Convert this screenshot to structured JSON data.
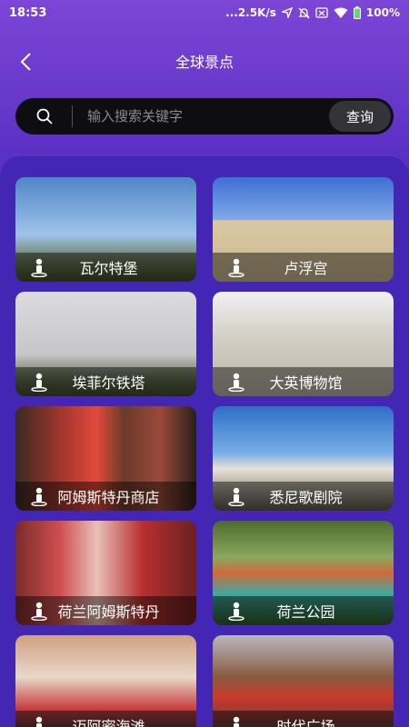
{
  "status_bar": {
    "time": "18:53",
    "network_speed": "...2.5K/s",
    "battery": "100%",
    "icons": [
      "location-icon",
      "mute-icon",
      "sim-icon",
      "wifi-icon",
      "battery-icon"
    ]
  },
  "header": {
    "title": "全球景点",
    "back_icon": "chevron-left-icon"
  },
  "search": {
    "placeholder": "输入搜索关键字",
    "value": "",
    "button_label": "查询"
  },
  "colors": {
    "background_top": "#7c46d6",
    "panel": "#4327b4",
    "search_bg": "#0e0e12",
    "search_button": "#333338"
  },
  "attractions": [
    {
      "name": "瓦尔特堡",
      "icon": "person-icon"
    },
    {
      "name": "卢浮宫",
      "icon": "person-icon"
    },
    {
      "name": "埃菲尔铁塔",
      "icon": "person-icon"
    },
    {
      "name": "大英博物馆",
      "icon": "person-icon"
    },
    {
      "name": "阿姆斯特丹商店",
      "icon": "person-icon"
    },
    {
      "name": "悉尼歌剧院",
      "icon": "person-icon"
    },
    {
      "name": "荷兰阿姆斯特丹",
      "icon": "person-icon"
    },
    {
      "name": "荷兰公园",
      "icon": "person-icon"
    },
    {
      "name": "迈阿密海滩",
      "icon": "person-icon"
    },
    {
      "name": "时代广场",
      "icon": "person-icon"
    }
  ]
}
